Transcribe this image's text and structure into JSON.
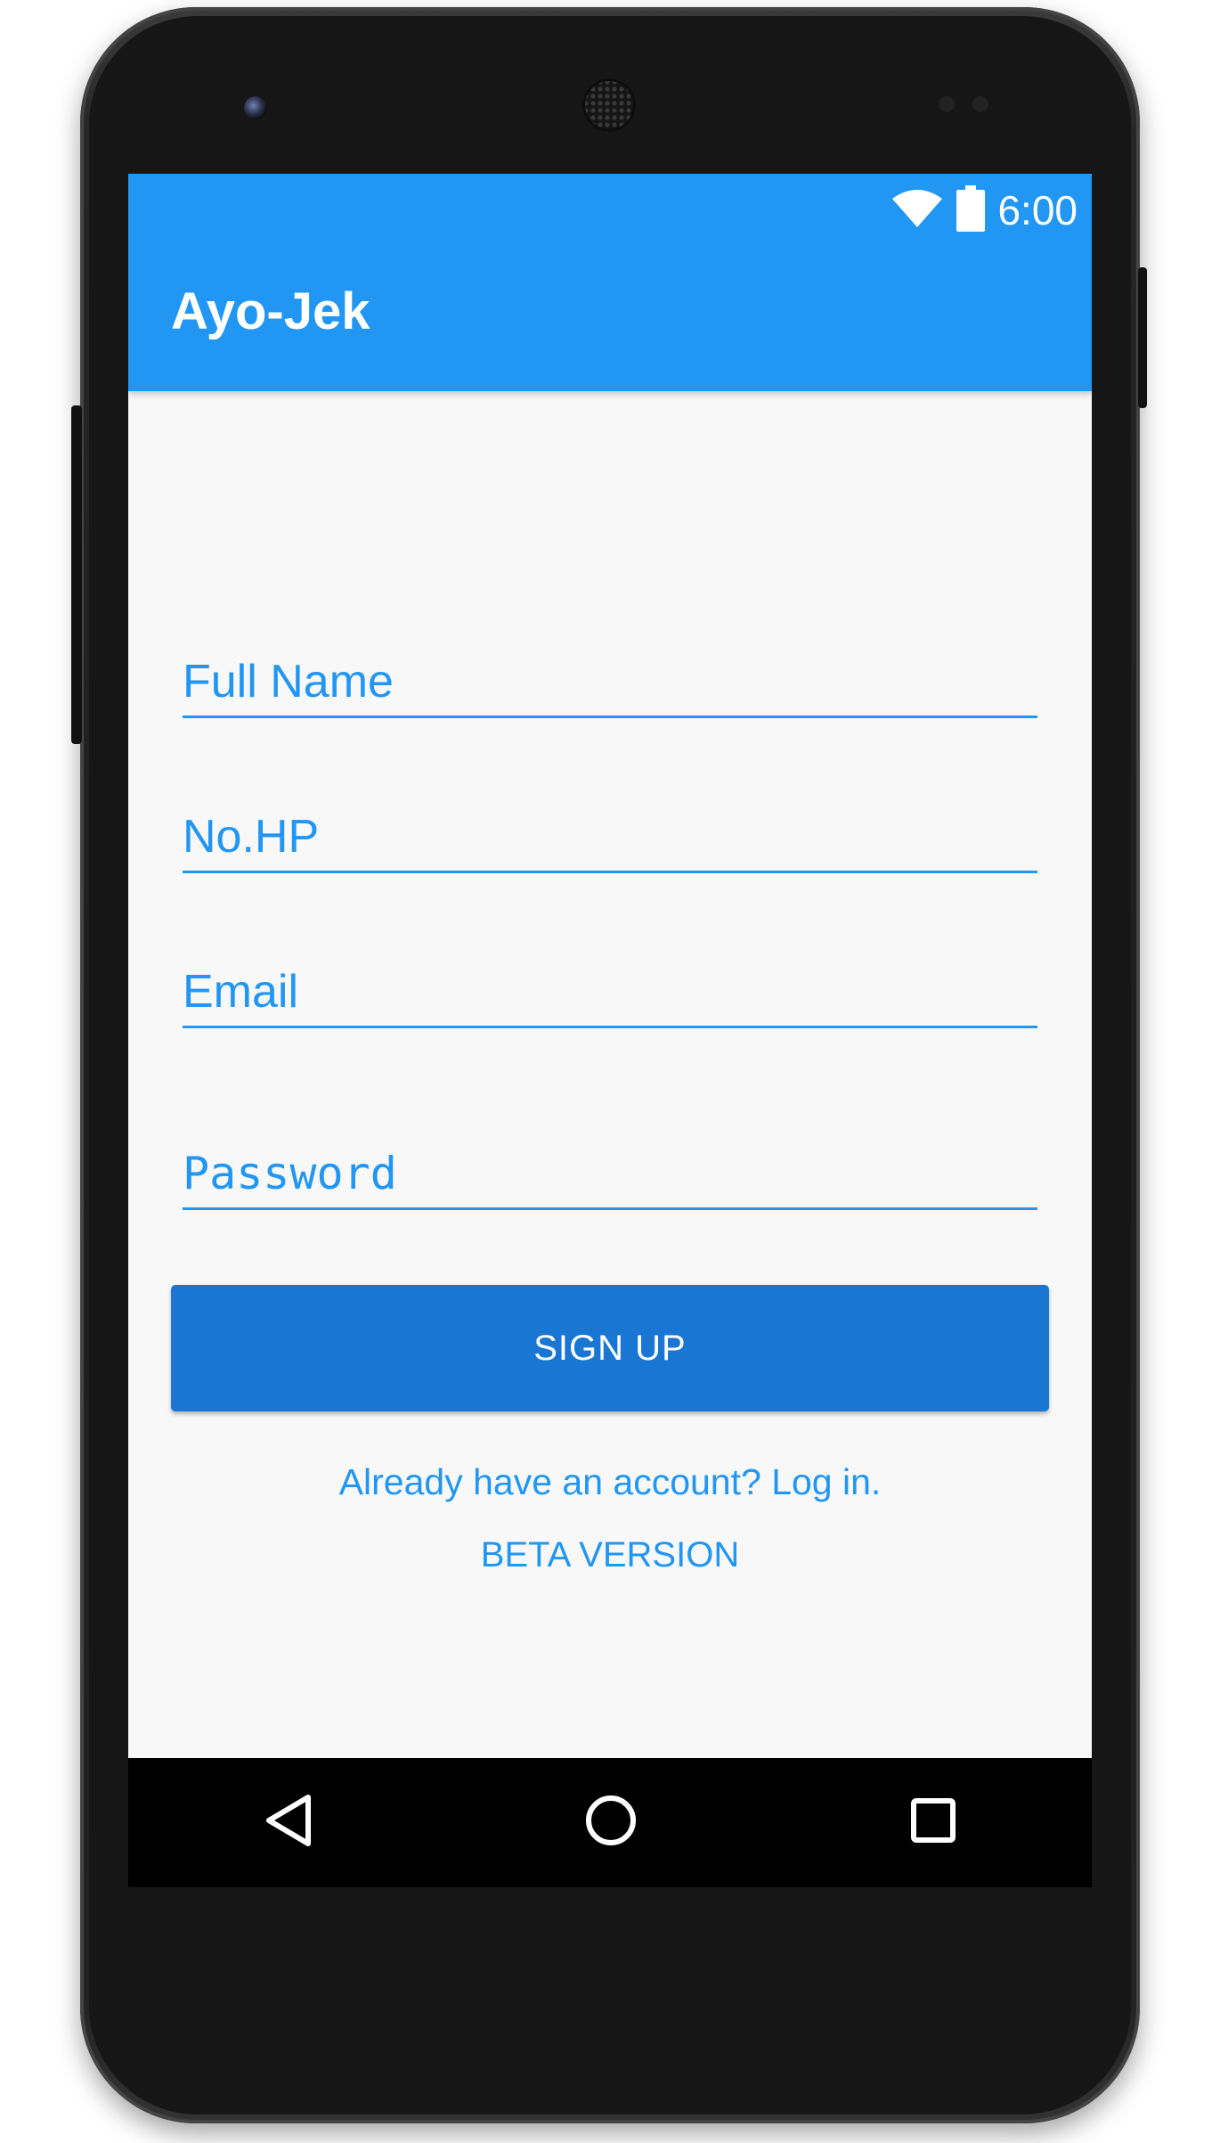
{
  "status_bar": {
    "time": "6:00",
    "icons": [
      "wifi-icon",
      "battery-icon"
    ]
  },
  "app_bar": {
    "title": "Ayo-Jek",
    "color": "#2196f3"
  },
  "form": {
    "full_name": {
      "placeholder": "Full Name",
      "value": ""
    },
    "phone": {
      "placeholder": "No.HP",
      "value": ""
    },
    "email": {
      "placeholder": "Email",
      "value": ""
    },
    "password": {
      "placeholder": "Password",
      "value": ""
    }
  },
  "actions": {
    "signup_label": "SIGN UP",
    "signup_color": "#1976d2",
    "login_link": "Already have an account? Log in.",
    "beta_label": "BETA VERSION"
  },
  "nav_bar": {
    "icons": [
      "back-icon",
      "home-icon",
      "recent-apps-icon"
    ]
  }
}
